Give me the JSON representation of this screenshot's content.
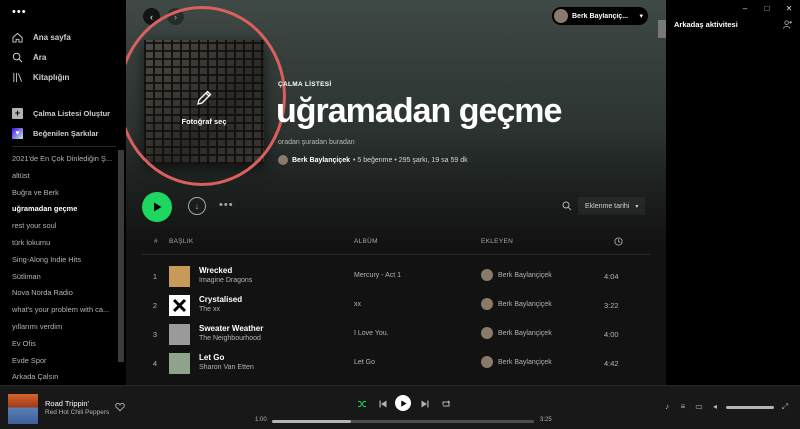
{
  "window": {
    "minimize": "–",
    "maximize": "□",
    "close": "✕"
  },
  "sidebar": {
    "menu_dots": "•••",
    "nav": [
      {
        "label": "Ana sayfa",
        "icon": "home-icon"
      },
      {
        "label": "Ara",
        "icon": "search-icon"
      },
      {
        "label": "Kitaplığın",
        "icon": "library-icon"
      }
    ],
    "actions": [
      {
        "label": "Çalma Listesi Oluştur",
        "icon": "plus-icon"
      },
      {
        "label": "Beğenilen Şarkılar",
        "icon": "liked-songs-icon"
      }
    ],
    "playlists": [
      "2021'de En Çok Dinlediğin Ş...",
      "altüst",
      "Buğra ve Berk",
      "uğramadan geçme",
      "rest your soul",
      "türk lokumu",
      "Sing-Along Indie Hits",
      "Sütliman",
      "Nova Norda Radio",
      "what's your problem with ca...",
      "yıllarımı verdim",
      "Ev Ofis",
      "Evde Spor",
      "Arkada Çalsın"
    ],
    "active_playlist_index": 3
  },
  "topbar": {
    "back": "‹",
    "forward": "›",
    "user_name": "Berk Baylançiç...",
    "user_caret": "▾"
  },
  "playlist": {
    "cover_action": "Fotoğraf seç",
    "type": "ÇALMA LİSTESİ",
    "title": "uğramadan geçme",
    "description": "oradan şuradan buradan",
    "owner": "Berk Baylançiçek",
    "meta": "• 5 beğenme • 295 şarkı, 19 sa 59 dk"
  },
  "actionbar": {
    "more": "•••",
    "sort_label": "Eklenme tarihi",
    "sort_caret": "▾"
  },
  "table": {
    "headers": {
      "num": "#",
      "title": "BAŞLIK",
      "album": "ALBÜM",
      "added_by": "EKLEYEN"
    },
    "rows": [
      {
        "num": "1",
        "title": "Wrecked",
        "artist": "Imagine Dragons",
        "album": "Mercury - Act 1",
        "added_by": "Berk Baylançiçek",
        "duration": "4:04",
        "art": "#c89a5a"
      },
      {
        "num": "2",
        "title": "Crystalised",
        "artist": "The xx",
        "album": "xx",
        "added_by": "Berk Baylançiçek",
        "duration": "3:22",
        "art": "#ffffff"
      },
      {
        "num": "3",
        "title": "Sweater Weather",
        "artist": "The Neighbourhood",
        "album": "I Love You.",
        "added_by": "Berk Baylançiçek",
        "duration": "4:00",
        "art": "#9a9a9a"
      },
      {
        "num": "4",
        "title": "Let Go",
        "artist": "Sharon Van Etten",
        "album": "Let Go",
        "added_by": "Berk Baylançiçek",
        "duration": "4:42",
        "art": "#8fa38a"
      }
    ]
  },
  "friends": {
    "title": "Arkadaş aktivitesi"
  },
  "player": {
    "track_title": "Road Trippin'",
    "track_artist": "Red Hot Chili Peppers",
    "elapsed": "1:00",
    "total": "3:25",
    "progress_fraction": 0.3,
    "accent": "#1ed760"
  }
}
